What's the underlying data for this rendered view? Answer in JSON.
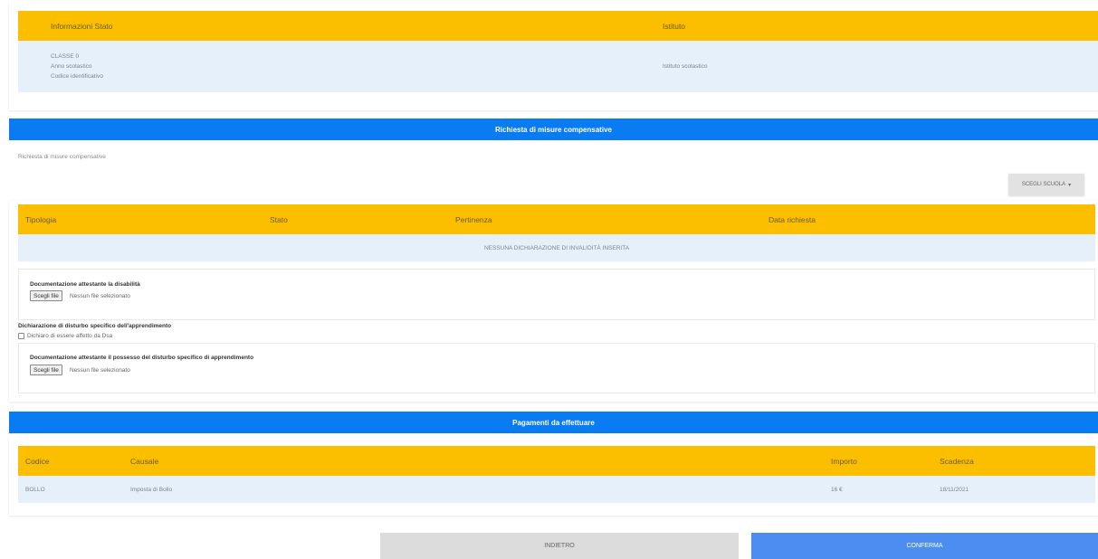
{
  "info": {
    "headers": [
      "Informazioni Stato",
      "Istituto"
    ],
    "student_lines": [
      "CLASSE 0",
      "Anno scolastico",
      "Codice identificativo"
    ],
    "institute": "Istituto scolastico"
  },
  "measures": {
    "title": "Richiesta di misure compensative",
    "subtitle": "Richiesta di misure compensative",
    "select_label": "SCEGLI SCUOLA",
    "headers": [
      "Tipologia",
      "Stato",
      "Pertinenza",
      "Data richiesta"
    ],
    "empty_row": "NESSUNA DICHIARAZIONE DI INVALIDITÀ INSERITA"
  },
  "disability_doc": {
    "title": "Documentazione attestante la disabilità",
    "choose_label": "Scegli file",
    "status": "Nessun file selezionato"
  },
  "dsa": {
    "title": "Dichiarazione di disturbo specifico dell'apprendimento",
    "checkbox_label": "Dichiaro di essere affetto da Dsa",
    "doc_title": "Documentazione attestante il possesso del disturbo specifico di apprendimento",
    "choose_label": "Scegli file",
    "status": "Nessun file selezionato"
  },
  "payments": {
    "title": "Pagamenti da effettuare",
    "headers": [
      "Codice",
      "Causale",
      "Importo",
      "Scadenza"
    ],
    "rows": [
      {
        "code": "BOLLO",
        "reason": "Imposta di Bollo",
        "amount": "16 €",
        "due": "18/11/2021"
      }
    ]
  },
  "actions": {
    "back_label": "INDIETRO",
    "confirm_label": "CONFERMA"
  },
  "colors": {
    "header_gold": "#fcbf00",
    "bar_blue": "#0a7cf3",
    "row_light_blue": "#e6f0fa",
    "confirm_blue": "#4b8df0",
    "back_grey": "#dcdcdc"
  }
}
